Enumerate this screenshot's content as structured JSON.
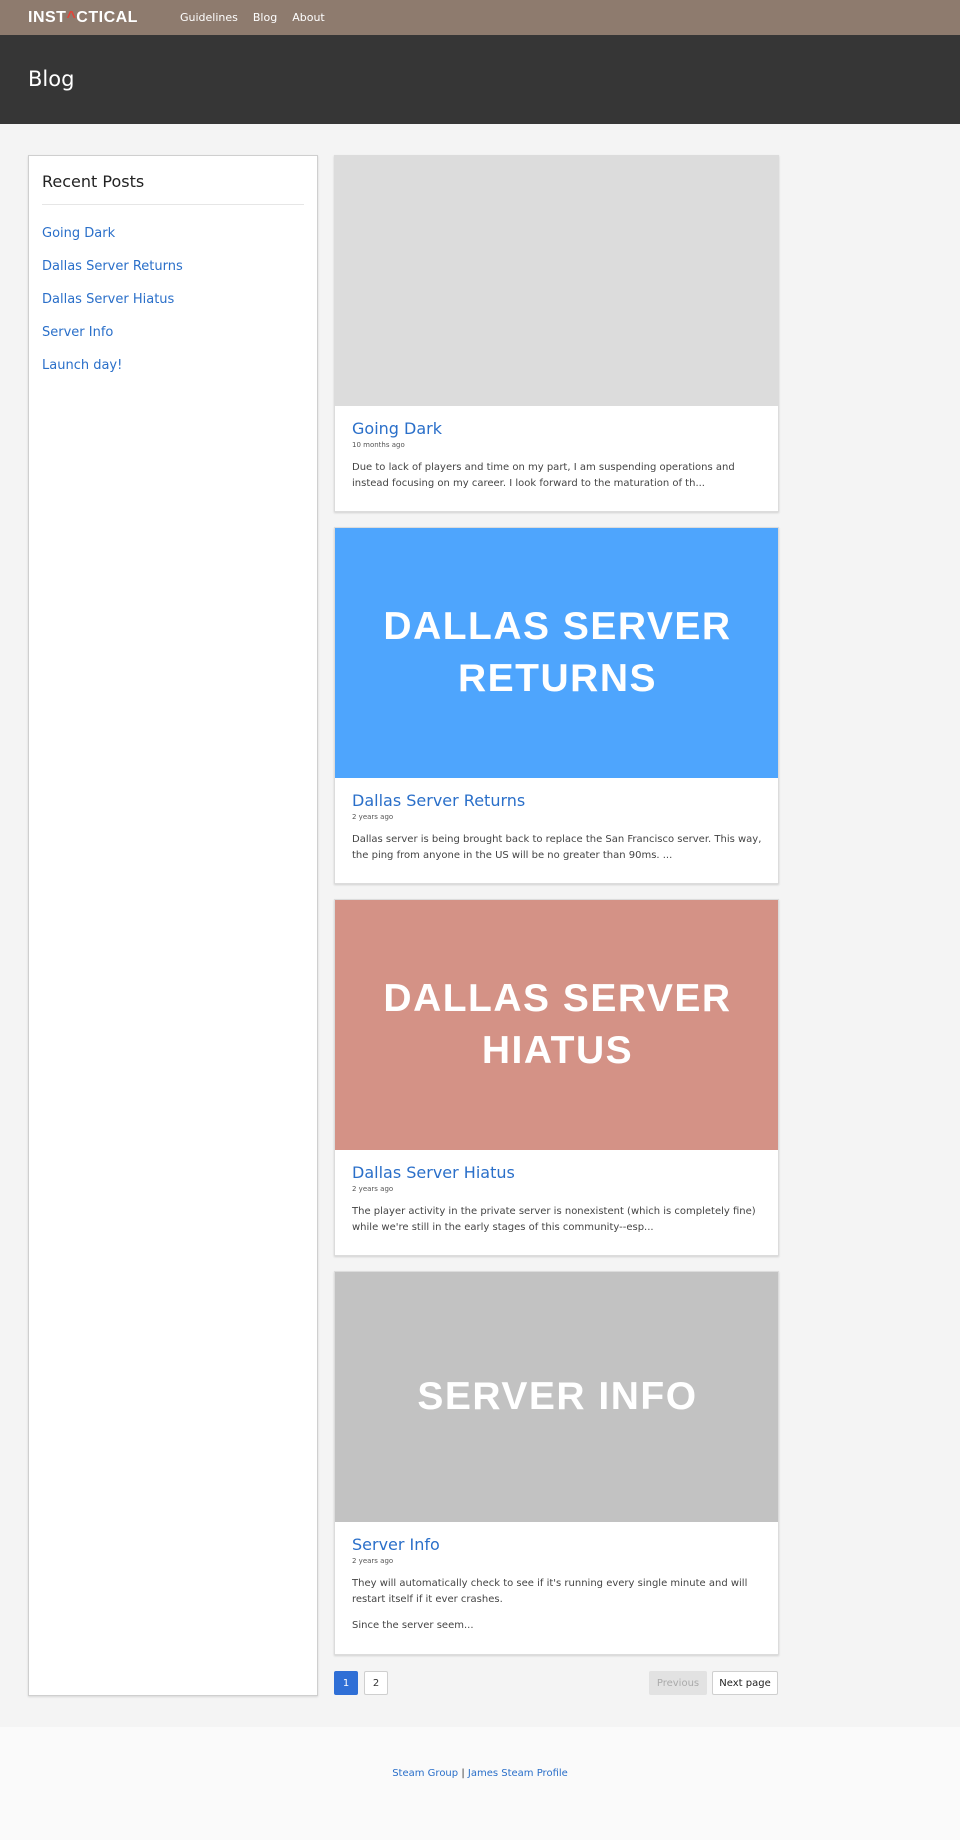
{
  "nav": {
    "logo_prefix": "INST",
    "logo_accent": "^",
    "logo_suffix": "CTICAL",
    "links": [
      "Guidelines",
      "Blog",
      "About"
    ]
  },
  "hero": {
    "title": "Blog"
  },
  "sidebar": {
    "heading": "Recent Posts",
    "items": [
      "Going Dark",
      "Dallas Server Returns",
      "Dallas Server Hiatus",
      "Server Info",
      "Launch day!"
    ]
  },
  "posts": [
    {
      "image_text": "",
      "image_color": "#dcdcdc",
      "title": "Going Dark",
      "date": "10 months ago",
      "excerpt": "Due to lack of players and time on my part, I am suspending operations and instead focusing on my career. I look forward to the maturation of th...",
      "excerpt2": ""
    },
    {
      "image_text": "DALLAS SERVER RETURNS",
      "image_color": "#4ea5fd",
      "title": "Dallas Server Returns",
      "date": "2 years ago",
      "excerpt": "Dallas server is being brought back to replace the San Francisco server. This way, the ping from anyone in the US will be no greater than 90ms. ...",
      "excerpt2": ""
    },
    {
      "image_text": "DALLAS SERVER HIATUS",
      "image_color": "#d49286",
      "title": "Dallas Server Hiatus",
      "date": "2 years ago",
      "excerpt": "The player activity in the private server is nonexistent (which is completely fine) while we're still in the early stages of this community--esp...",
      "excerpt2": ""
    },
    {
      "image_text": "SERVER INFO",
      "image_color": "#c2c2c2",
      "title": "Server Info",
      "date": "2 years ago",
      "excerpt": "They will automatically check to see if it's running every single minute and will restart itself if it ever crashes.",
      "excerpt2": "Since the server seem..."
    }
  ],
  "pagination": {
    "pages": [
      "1",
      "2"
    ],
    "previous": "Previous",
    "next": "Next page"
  },
  "footer": {
    "link1": "Steam Group",
    "separator": "|",
    "link2": "James Steam Profile"
  },
  "colors": {
    "accent": "#2a6fc9",
    "nav_bg": "#8e7b6e",
    "hero_bg": "#363636",
    "logo_accent": "#e0453a"
  }
}
